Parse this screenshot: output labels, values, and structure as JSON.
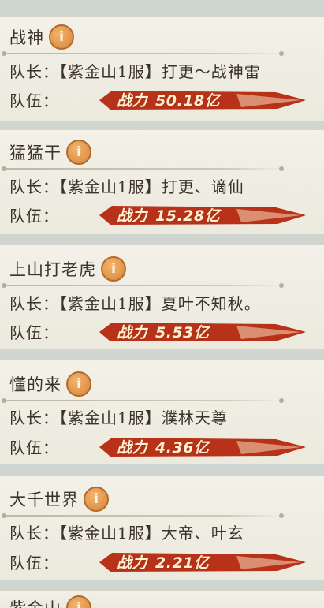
{
  "labels": {
    "captain": "队长：",
    "team": "队伍：",
    "power": "战力"
  },
  "teams": [
    {
      "name": "战神",
      "captain": "【紫金山1服】打更～战神雷",
      "power": "50.18亿"
    },
    {
      "name": "猛猛干",
      "captain": "【紫金山1服】打更、谪仙",
      "power": "15.28亿"
    },
    {
      "name": "上山打老虎",
      "captain": "【紫金山1服】夏叶不知秋。",
      "power": "5.53亿"
    },
    {
      "name": "懂的来",
      "captain": "【紫金山1服】濮林天尊",
      "power": "4.36亿"
    },
    {
      "name": "大千世界",
      "captain": "【紫金山1服】大帝、叶玄",
      "power": "2.21亿"
    },
    {
      "name": "紫金山",
      "captain": "",
      "power": ""
    }
  ],
  "colors": {
    "bar_dark": "#b8321a",
    "bar_light": "#e8b79a",
    "icon": "#e09a52"
  },
  "icons": {
    "info": "info-icon"
  }
}
